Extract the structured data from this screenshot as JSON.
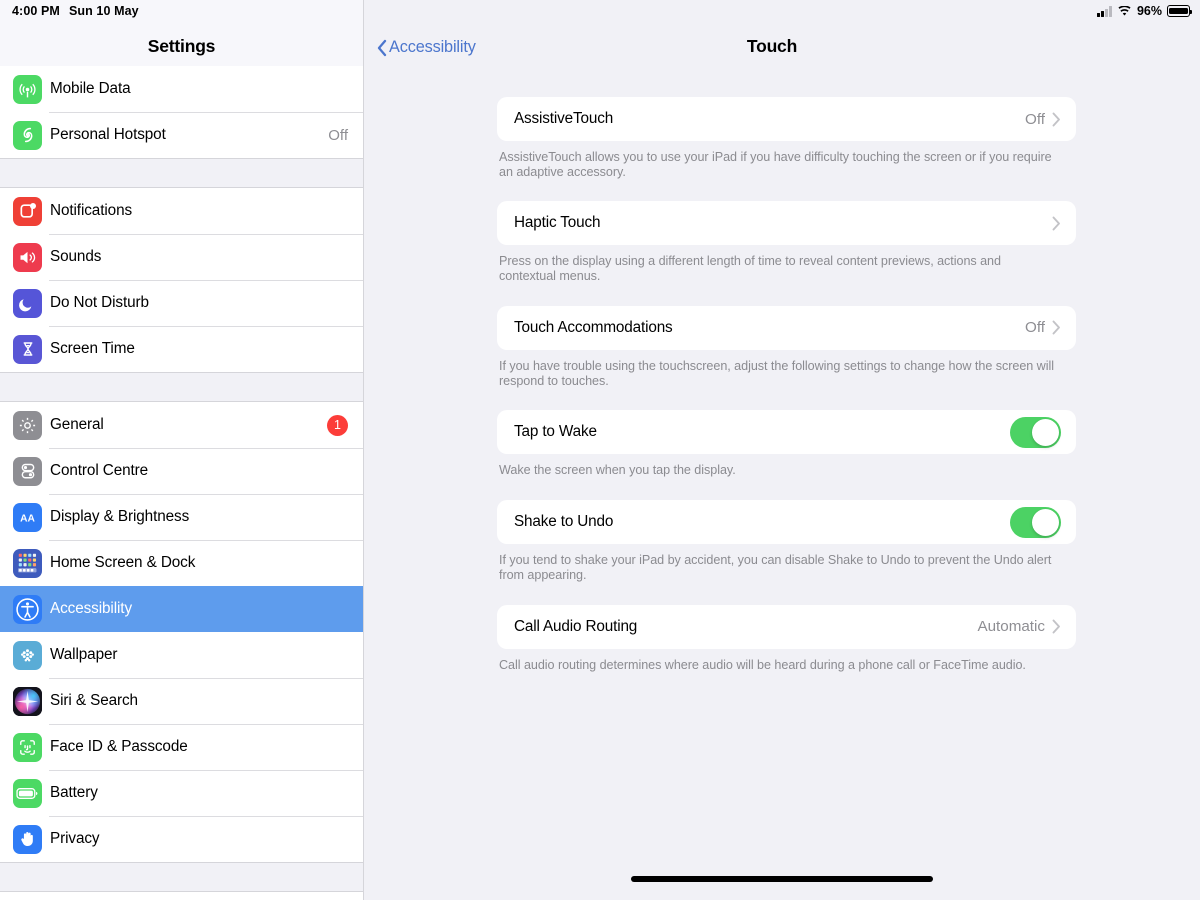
{
  "status_bar": {
    "time": "4:00 PM",
    "date": "Sun 10 May",
    "signal_icon": "cellular-signal-icon",
    "wifi_icon": "wifi-icon",
    "battery_percent": "96%",
    "battery_icon": "battery-icon"
  },
  "sidebar": {
    "title": "Settings",
    "groups": [
      {
        "items": [
          {
            "label": "Mobile Data",
            "value": "",
            "icon": "mobile-data-icon",
            "icon_bg": "#4cd964"
          },
          {
            "label": "Personal Hotspot",
            "value": "Off",
            "icon": "personal-hotspot-icon",
            "icon_bg": "#4cd964"
          }
        ]
      },
      {
        "items": [
          {
            "label": "Notifications",
            "value": "",
            "icon": "notifications-icon",
            "icon_bg": "#ef4036"
          },
          {
            "label": "Sounds",
            "value": "",
            "icon": "sounds-icon",
            "icon_bg": "#ee3b4e"
          },
          {
            "label": "Do Not Disturb",
            "value": "",
            "icon": "moon-icon",
            "icon_bg": "#5555d8"
          },
          {
            "label": "Screen Time",
            "value": "",
            "icon": "hourglass-icon",
            "icon_bg": "#5956d5"
          }
        ]
      },
      {
        "items": [
          {
            "label": "General",
            "value": "",
            "badge": "1",
            "icon": "gear-icon",
            "icon_bg": "#8e8e93"
          },
          {
            "label": "Control Centre",
            "value": "",
            "icon": "control-centre-icon",
            "icon_bg": "#8e8e93"
          },
          {
            "label": "Display & Brightness",
            "value": "",
            "icon": "display-brightness-icon",
            "icon_bg": "#2f7cf6"
          },
          {
            "label": "Home Screen & Dock",
            "value": "",
            "icon": "home-screen-dock-icon",
            "icon_bg": "#3e5bbd"
          },
          {
            "label": "Accessibility",
            "value": "",
            "selected": true,
            "icon": "accessibility-icon",
            "icon_bg": "#2f7cf6"
          },
          {
            "label": "Wallpaper",
            "value": "",
            "icon": "wallpaper-icon",
            "icon_bg": "#5aacd6"
          },
          {
            "label": "Siri & Search",
            "value": "",
            "icon": "siri-icon",
            "icon_bg": "#1c1c28"
          },
          {
            "label": "Face ID & Passcode",
            "value": "",
            "icon": "face-id-icon",
            "icon_bg": "#4cd964"
          },
          {
            "label": "Battery",
            "value": "",
            "icon": "battery-settings-icon",
            "icon_bg": "#4cd964"
          },
          {
            "label": "Privacy",
            "value": "",
            "icon": "privacy-hand-icon",
            "icon_bg": "#2f7cf6"
          }
        ]
      }
    ]
  },
  "detail": {
    "back_label": "Accessibility",
    "back_icon": "chevron-left-icon",
    "title": "Touch",
    "blocks": [
      {
        "label": "AssistiveTouch",
        "value": "Off",
        "control": "chevron",
        "footnote": "AssistiveTouch allows you to use your iPad if you have difficulty touching the screen or if you require an adaptive accessory."
      },
      {
        "label": "Haptic Touch",
        "value": "",
        "control": "chevron",
        "footnote": "Press on the display using a different length of time to reveal content previews, actions and contextual menus."
      },
      {
        "label": "Touch Accommodations",
        "value": "Off",
        "control": "chevron",
        "footnote": "If you have trouble using the touchscreen, adjust the following settings to change how the screen will respond to touches."
      },
      {
        "label": "Tap to Wake",
        "value": "",
        "control": "toggle",
        "toggle_on": true,
        "footnote": "Wake the screen when you tap the display."
      },
      {
        "label": "Shake to Undo",
        "value": "",
        "control": "toggle",
        "toggle_on": true,
        "footnote": "If you tend to shake your iPad by accident, you can disable Shake to Undo to prevent the Undo alert from appearing."
      },
      {
        "label": "Call Audio Routing",
        "value": "Automatic",
        "control": "chevron",
        "footnote": "Call audio routing determines where audio will be heard during a phone call or FaceTime audio."
      }
    ]
  },
  "colors": {
    "accent_blue": "#4c76cd",
    "selection_blue": "#5e9ced",
    "toggle_green": "#4cd264",
    "badge_red": "#fc3d39",
    "background": "#f1f1f6",
    "secondary_text": "#8e8e93"
  },
  "home_indicator": "home-indicator"
}
